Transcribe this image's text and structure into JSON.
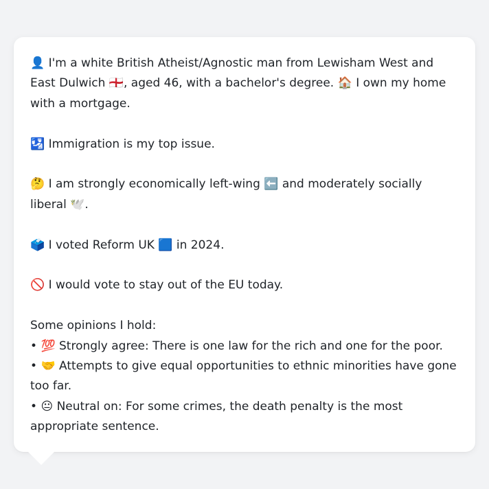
{
  "profile": {
    "intro_icon": "👤",
    "intro_text": " I'm a white British Atheist/Agnostic man from Lewisham West and East Dulwich ",
    "flag_icon": "🏴󠁧󠁢󠁥󠁮󠁧󠁿",
    "intro_text2": ", aged 46, with a bachelor's degree. ",
    "home_icon": "🏠",
    "intro_text3": " I own my home with a mortgage."
  },
  "issue": {
    "icon": "🛂",
    "text": " Immigration is my top issue."
  },
  "position": {
    "icon": "🤔",
    "text": " I am strongly economically left-wing ",
    "left_icon": "⬅️",
    "text2": " and moderately socially liberal ",
    "dove_icon": "🕊️",
    "text3": "."
  },
  "vote": {
    "icon": "🗳️",
    "text": " I voted Reform UK ",
    "party_icon": "🟦",
    "text2": " in 2024."
  },
  "eu": {
    "icon": "🚫",
    "text": " I would vote to stay out of the EU today."
  },
  "opinions": {
    "heading": "Some opinions I hold:",
    "items": [
      {
        "bullet": "• ",
        "icon": "💯",
        "text": " Strongly agree: There is one law for the rich and one for the poor."
      },
      {
        "bullet": "• ",
        "icon": "🤝",
        "text": " Attempts to give equal opportunities to ethnic minorities have gone too far."
      },
      {
        "bullet": "• ",
        "icon": "😐",
        "text": " Neutral on: For some crimes, the death penalty is the most appropriate sentence."
      }
    ]
  }
}
